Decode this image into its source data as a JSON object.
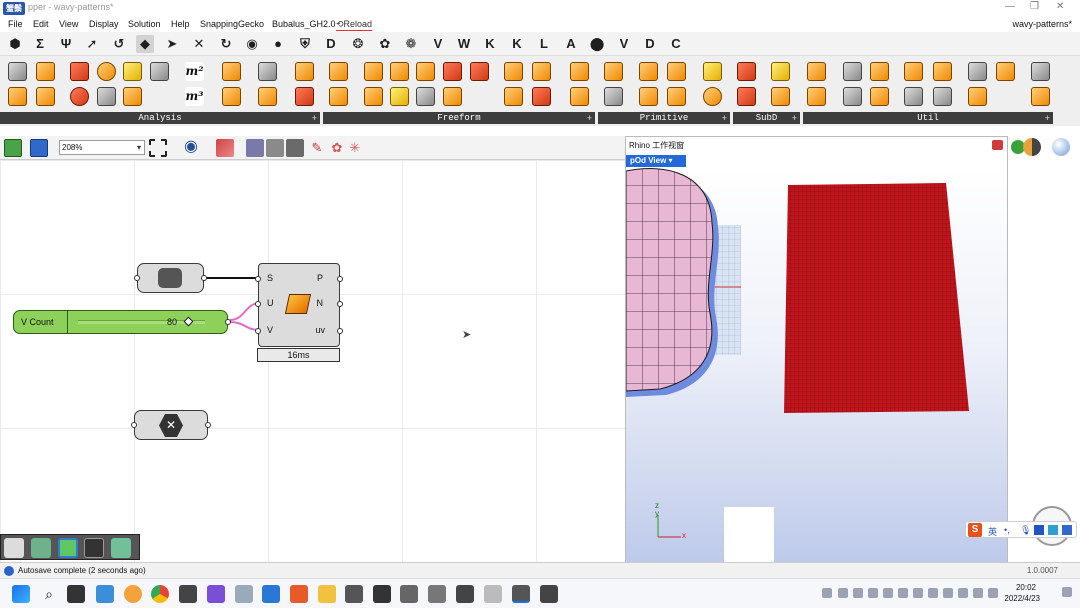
{
  "window": {
    "app_icon_text": "蟹鬃",
    "title_text": "pper - wavy-patterns*",
    "document_title": "wavy-patterns*"
  },
  "menu": {
    "items": [
      "File",
      "Edit",
      "View",
      "Display",
      "Solution",
      "Help",
      "SnappingGecko",
      "Bubalus_GH2.0",
      "Reload"
    ]
  },
  "tabs": {
    "letters": [
      "D",
      "W",
      "K",
      "K",
      "L",
      "A",
      "V",
      "D",
      "C"
    ],
    "active_index": 7
  },
  "ribbon": {
    "groups": [
      {
        "label": "Analysis"
      },
      {
        "label": "Freeform"
      },
      {
        "label": "Primitive"
      },
      {
        "label": "SubD"
      },
      {
        "label": "Util"
      }
    ],
    "plus": "+",
    "m2": "m²",
    "m3": "m³"
  },
  "canvas_toolbar": {
    "zoom_value": "208%"
  },
  "canvas": {
    "component": {
      "inputs": [
        "S",
        "U",
        "V"
      ],
      "outputs": [
        "P",
        "N",
        "uv"
      ],
      "timing": "16ms"
    },
    "slider": {
      "name": "V Count",
      "value": "80"
    }
  },
  "status": {
    "message": "Autosave complete (2 seconds ago)",
    "version": "1.0.0007"
  },
  "rhino": {
    "title": "Rhino 工作视窗",
    "view_tab": "pOd View",
    "axis_z": "z",
    "axis_y": "y",
    "axis_x": "x"
  },
  "ime": {
    "logo": "S",
    "lang": "英"
  },
  "taskbar": {
    "time": "20:02",
    "date": "2022/4/23"
  },
  "colors": {
    "slider_green": "#8dd05a",
    "surface_red": "#c0141b",
    "blob_pink": "#e7b7d3",
    "blob_blue": "#6f8be0",
    "accent_blue": "#2469d8"
  }
}
